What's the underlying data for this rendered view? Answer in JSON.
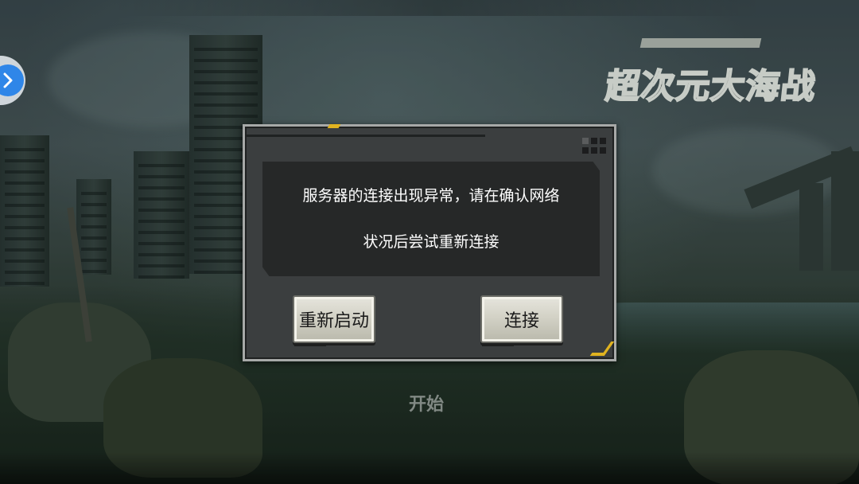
{
  "dialog": {
    "message_line1": "服务器的连接出现异常，请在确认网络",
    "message_line2": "状况后尝试重新连接",
    "restart_label": "重新启动",
    "connect_label": "连接"
  },
  "background": {
    "start_label": "开始",
    "logo_title": "超次元大海战"
  },
  "icons": {
    "float_button": "chevron-right-icon"
  },
  "colors": {
    "accent": "#e0b320",
    "float_button": "#2f86e8"
  }
}
